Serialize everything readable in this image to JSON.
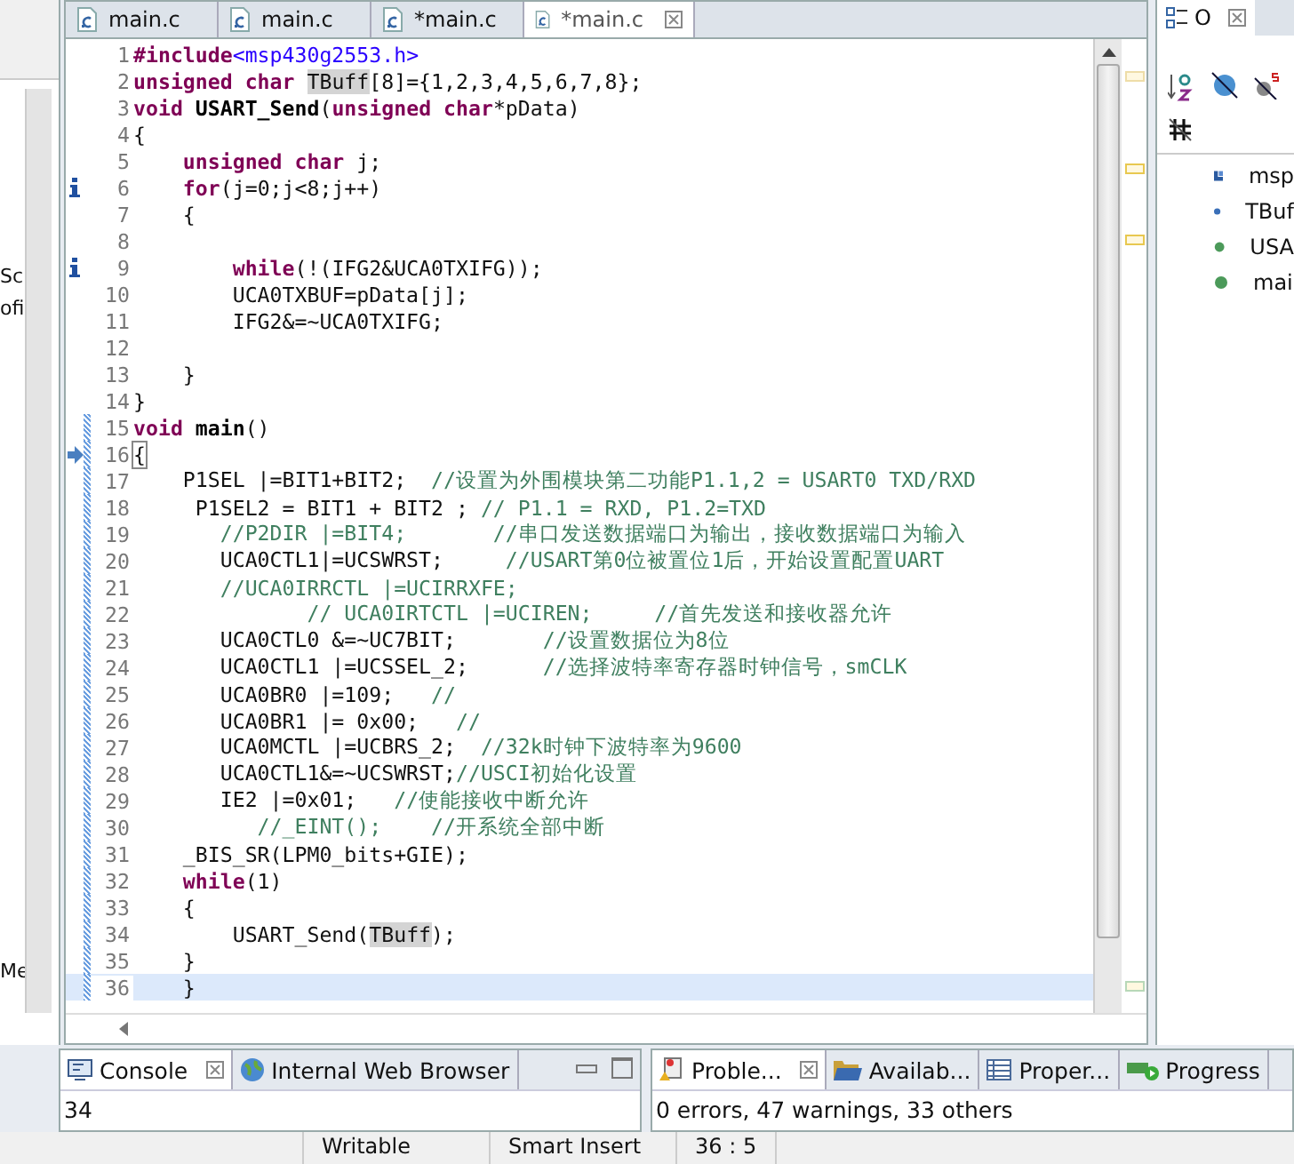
{
  "side_panel": {
    "fragments": [
      "Sc",
      "ofi",
      "Me"
    ]
  },
  "editor_tabs": [
    {
      "label": "main.c",
      "selected": false
    },
    {
      "label": "main.c",
      "selected": false
    },
    {
      "label": "*main.c",
      "selected": false
    },
    {
      "label": "*main.c",
      "selected": true
    }
  ],
  "code_lines": [
    {
      "num": "1",
      "changed": false,
      "current": false,
      "tokens": [
        {
          "kind": "directive",
          "text": "#include"
        },
        {
          "kind": "header",
          "text": "<msp430g2553.h>"
        }
      ]
    },
    {
      "num": "2",
      "changed": false,
      "current": false,
      "tokens": [
        {
          "kind": "keyword",
          "text": "unsigned char "
        },
        {
          "kind": "occurrence",
          "text": "TBuff"
        },
        {
          "kind": "plain",
          "text": "[8]={1,2,3,4,5,6,7,8};"
        }
      ]
    },
    {
      "num": "3",
      "changed": false,
      "current": false,
      "tokens": [
        {
          "kind": "keyword",
          "text": "void "
        },
        {
          "kind": "function",
          "text": "USART_Send"
        },
        {
          "kind": "plain",
          "text": "("
        },
        {
          "kind": "keyword",
          "text": "unsigned char"
        },
        {
          "kind": "plain",
          "text": "*pData)"
        }
      ]
    },
    {
      "num": "4",
      "changed": false,
      "current": false,
      "tokens": [
        {
          "kind": "plain",
          "text": "{"
        }
      ]
    },
    {
      "num": "5",
      "changed": false,
      "current": false,
      "tokens": [
        {
          "kind": "keyword",
          "text": "    unsigned char "
        },
        {
          "kind": "plain",
          "text": "j;"
        }
      ]
    },
    {
      "num": "6",
      "changed": false,
      "current": false,
      "marker": {
        "kind": "info"
      },
      "tokens": [
        {
          "kind": "keyword",
          "text": "    for"
        },
        {
          "kind": "plain",
          "text": "(j=0;j<8;j++)"
        }
      ]
    },
    {
      "num": "7",
      "changed": false,
      "current": false,
      "tokens": [
        {
          "kind": "plain",
          "text": "    {"
        }
      ]
    },
    {
      "num": "8",
      "changed": false,
      "current": false
    },
    {
      "num": "9",
      "changed": false,
      "current": false,
      "marker": {
        "kind": "info"
      },
      "tokens": [
        {
          "kind": "keyword",
          "text": "        while"
        },
        {
          "kind": "plain",
          "text": "(!(IFG2&UCA0TXIFG));"
        }
      ]
    },
    {
      "num": "10",
      "changed": false,
      "current": false,
      "tokens": [
        {
          "kind": "plain",
          "text": "        UCA0TXBUF=pData[j];"
        }
      ]
    },
    {
      "num": "11",
      "changed": false,
      "current": false,
      "tokens": [
        {
          "kind": "plain",
          "text": "        IFG2&=~UCA0TXIFG;"
        }
      ]
    },
    {
      "num": "12",
      "changed": false,
      "current": false
    },
    {
      "num": "13",
      "changed": false,
      "current": false,
      "tokens": [
        {
          "kind": "plain",
          "text": "    }"
        }
      ]
    },
    {
      "num": "14",
      "changed": false,
      "current": false,
      "tokens": [
        {
          "kind": "plain",
          "text": "}"
        }
      ]
    },
    {
      "num": "15",
      "changed": true,
      "current": false,
      "tokens": [
        {
          "kind": "keyword",
          "text": "void "
        },
        {
          "kind": "function",
          "text": "main"
        },
        {
          "kind": "plain",
          "text": "()"
        }
      ]
    },
    {
      "num": "16",
      "changed": true,
      "current": false,
      "marker": {
        "kind": "arrow"
      },
      "tokens": [
        {
          "kind": "matched",
          "text": "{"
        }
      ]
    },
    {
      "num": "17",
      "changed": true,
      "current": false,
      "tokens": [
        {
          "kind": "plain",
          "text": "    P1SEL |=BIT1+BIT2;  "
        },
        {
          "kind": "comment",
          "text": "//设置为外围模块第二功能P1.1,2 = USART0 TXD/RXD"
        }
      ]
    },
    {
      "num": "18",
      "changed": true,
      "current": false,
      "tokens": [
        {
          "kind": "plain",
          "text": "     P1SEL2 = BIT1 + BIT2 ; "
        },
        {
          "kind": "comment",
          "text": "// P1.1 = RXD, P1.2=TXD"
        }
      ]
    },
    {
      "num": "19",
      "changed": true,
      "current": false,
      "tokens": [
        {
          "kind": "comment",
          "text": "       //P2DIR |=BIT4;       //串口发送数据端口为输出，接收数据端口为输入"
        }
      ]
    },
    {
      "num": "20",
      "changed": true,
      "current": false,
      "tokens": [
        {
          "kind": "plain",
          "text": "       UCA0CTL1|=UCSWRST;     "
        },
        {
          "kind": "comment",
          "text": "//USART第0位被置位1后，开始设置配置UART"
        }
      ]
    },
    {
      "num": "21",
      "changed": true,
      "current": false,
      "tokens": [
        {
          "kind": "comment",
          "text": "       //UCA0IRRCTL |=UCIRRXFE;"
        }
      ]
    },
    {
      "num": "22",
      "changed": true,
      "current": false,
      "tokens": [
        {
          "kind": "comment",
          "text": "              // UCA0IRTCTL |=UCIREN;     //首先发送和接收器允许"
        }
      ]
    },
    {
      "num": "23",
      "changed": true,
      "current": false,
      "tokens": [
        {
          "kind": "plain",
          "text": "       UCA0CTL0 &=~UC7BIT;       "
        },
        {
          "kind": "comment",
          "text": "//设置数据位为8位"
        }
      ]
    },
    {
      "num": "24",
      "changed": true,
      "current": false,
      "tokens": [
        {
          "kind": "plain",
          "text": "       UCA0CTL1 |=UCSSEL_2;      "
        },
        {
          "kind": "comment",
          "text": "//选择波特率寄存器时钟信号，smCLK"
        }
      ]
    },
    {
      "num": "25",
      "changed": true,
      "current": false,
      "tokens": [
        {
          "kind": "plain",
          "text": "       UCA0BR0 |=109;   "
        },
        {
          "kind": "comment",
          "text": "//"
        }
      ]
    },
    {
      "num": "26",
      "changed": true,
      "current": false,
      "tokens": [
        {
          "kind": "plain",
          "text": "       UCA0BR1 |= 0x00;   "
        },
        {
          "kind": "comment",
          "text": "//"
        }
      ]
    },
    {
      "num": "27",
      "changed": true,
      "current": false,
      "tokens": [
        {
          "kind": "plain",
          "text": "       UCA0MCTL |=UCBRS_2;  "
        },
        {
          "kind": "comment",
          "text": "//32k时钟下波特率为9600"
        }
      ]
    },
    {
      "num": "28",
      "changed": true,
      "current": false,
      "tokens": [
        {
          "kind": "plain",
          "text": "       UCA0CTL1&=~UCSWRST;"
        },
        {
          "kind": "comment",
          "text": "//USCI初始化设置"
        }
      ]
    },
    {
      "num": "29",
      "changed": true,
      "current": false,
      "tokens": [
        {
          "kind": "plain",
          "text": "       IE2 |=0x01;   "
        },
        {
          "kind": "comment",
          "text": "//使能接收中断允许"
        }
      ]
    },
    {
      "num": "30",
      "changed": true,
      "current": false,
      "tokens": [
        {
          "kind": "comment",
          "text": "          //_EINT();    //开系统全部中断"
        }
      ]
    },
    {
      "num": "31",
      "changed": true,
      "current": false,
      "tokens": [
        {
          "kind": "plain",
          "text": "    _BIS_SR(LPM0_bits+GIE);"
        }
      ]
    },
    {
      "num": "32",
      "changed": true,
      "current": false,
      "tokens": [
        {
          "kind": "keyword",
          "text": "    while"
        },
        {
          "kind": "plain",
          "text": "(1)"
        }
      ]
    },
    {
      "num": "33",
      "changed": true,
      "current": false,
      "tokens": [
        {
          "kind": "plain",
          "text": "    {"
        }
      ]
    },
    {
      "num": "34",
      "changed": true,
      "current": false,
      "tokens": [
        {
          "kind": "plain",
          "text": "        USART_Send("
        },
        {
          "kind": "occurrence",
          "text": "TBuff"
        },
        {
          "kind": "plain",
          "text": ");"
        }
      ]
    },
    {
      "num": "35",
      "changed": true,
      "current": false,
      "tokens": [
        {
          "kind": "plain",
          "text": "    }"
        }
      ]
    },
    {
      "num": "36",
      "changed": true,
      "current": true,
      "tokens": [
        {
          "kind": "plain",
          "text": "    }"
        }
      ]
    }
  ],
  "outline": {
    "tab": {
      "label": "O",
      "selected": true
    },
    "items": [
      {
        "kind": "include",
        "label": "msp"
      },
      {
        "kind": "variable",
        "label": "TBuf"
      },
      {
        "kind": "function",
        "label": "USA"
      },
      {
        "kind": "function",
        "label": "mai"
      }
    ]
  },
  "console_panel": {
    "tabs": [
      {
        "label": "Console",
        "selected": true
      },
      {
        "label": "Internal Web Browser",
        "selected": false
      }
    ],
    "output": "34"
  },
  "problems_panel": {
    "tabs": [
      {
        "label": "Proble...",
        "selected": true,
        "kind": "problems"
      },
      {
        "label": "Availab...",
        "selected": false,
        "kind": "folder"
      },
      {
        "label": "Proper...",
        "selected": false,
        "kind": "properties"
      },
      {
        "label": "Progress",
        "selected": false,
        "kind": "progress"
      }
    ],
    "summary": "0 errors, 47 warnings, 33 others"
  },
  "status_bar": [
    "Writable",
    "Smart Insert",
    "36 : 5"
  ]
}
